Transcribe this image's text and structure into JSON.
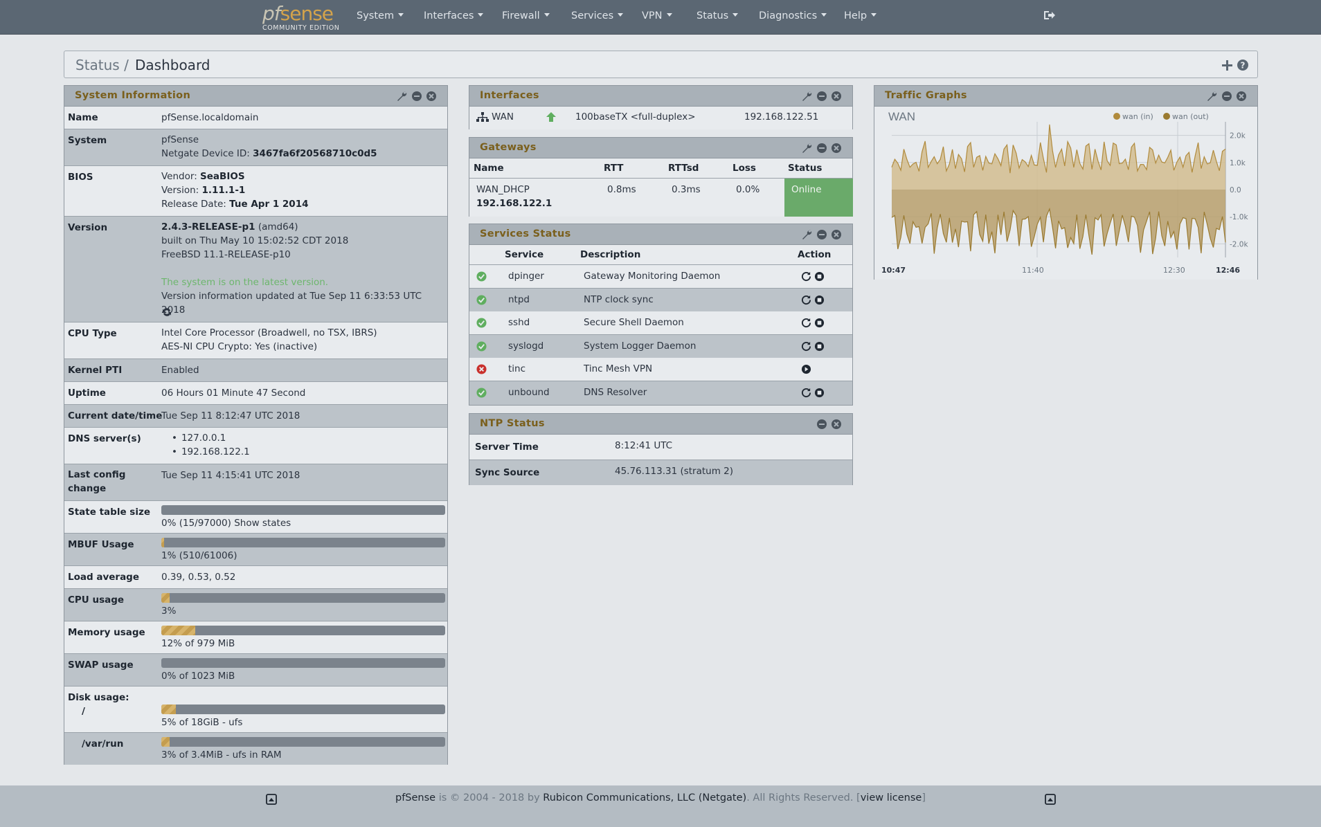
{
  "navbar": {
    "logo_main_pf": "pf",
    "logo_main_sense": "sense",
    "logo_sub": "COMMUNITY EDITION",
    "menu": [
      "System",
      "Interfaces",
      "Firewall",
      "Services",
      "VPN",
      "Status",
      "Diagnostics",
      "Help"
    ]
  },
  "breadcrumb": {
    "parent": "Status /",
    "current": "Dashboard"
  },
  "system_info": {
    "title": "System Information",
    "name_label": "Name",
    "name_value": "pfSense.localdomain",
    "system_label": "System",
    "system_value": "pfSense",
    "device_id_prefix": "Netgate Device ID:",
    "device_id": "3467fa6f20568710c0d5",
    "bios_label": "BIOS",
    "bios_vendor_prefix": "Vendor:",
    "bios_vendor": "SeaBIOS",
    "bios_version_prefix": "Version:",
    "bios_version": "1.11.1-1",
    "bios_date_prefix": "Release Date:",
    "bios_date": "Tue Apr 1 2014",
    "version_label": "Version",
    "version_value": "2.4.3-RELEASE-p1",
    "version_arch": "(amd64)",
    "version_built": "built on Thu May 10 15:02:52 CDT 2018",
    "version_freebsd": "FreeBSD 11.1-RELEASE-p10",
    "version_latest": "The system is on the latest version.",
    "version_updated": "Version information updated at Tue Sep 11 6:33:53 UTC 2018",
    "cpu_label": "CPU Type",
    "cpu_value": "Intel Core Processor (Broadwell, no TSX, IBRS)",
    "cpu_crypto": "AES-NI CPU Crypto: Yes (inactive)",
    "kpti_label": "Kernel PTI",
    "kpti_value": "Enabled",
    "uptime_label": "Uptime",
    "uptime_value": "06 Hours 01 Minute 47 Second",
    "datetime_label": "Current date/time",
    "datetime_value": "Tue Sep 11 8:12:47 UTC 2018",
    "dns_label": "DNS server(s)",
    "dns_1": "127.0.0.1",
    "dns_2": "192.168.122.1",
    "lastconfig_label": "Last config change",
    "lastconfig_value": "Tue Sep 11 4:15:41 UTC 2018",
    "state_label": "State table size",
    "state_value": "0% (15/97000)",
    "state_link": "Show states",
    "state_pct": 0,
    "mbuf_label": "MBUF Usage",
    "mbuf_value": "1% (510/61006)",
    "mbuf_pct": 1,
    "load_label": "Load average",
    "load_value": "0.39, 0.53, 0.52",
    "cpu_usage_label": "CPU usage",
    "cpu_usage_value": "3%",
    "cpu_usage_pct": 3,
    "mem_label": "Memory usage",
    "mem_value": "12% of 979 MiB",
    "mem_pct": 12,
    "swap_label": "SWAP usage",
    "swap_value": "0% of 1023 MiB",
    "swap_pct": 0,
    "disk_label": "Disk usage:",
    "disk_root_label": "/",
    "disk_root_value": "5% of 18GiB - ufs",
    "disk_root_pct": 5,
    "disk_varrun_label": "/var/run",
    "disk_varrun_value": "3% of 3.4MiB - ufs in RAM",
    "disk_varrun_pct": 3
  },
  "interfaces": {
    "title": "Interfaces",
    "rows": [
      {
        "name": "WAN",
        "media": "100baseTX <full-duplex>",
        "ip": "192.168.122.51"
      }
    ]
  },
  "gateways": {
    "title": "Gateways",
    "headers": [
      "Name",
      "RTT",
      "RTTsd",
      "Loss",
      "Status"
    ],
    "rows": [
      {
        "name": "WAN_DHCP",
        "ip": "192.168.122.1",
        "rtt": "0.8ms",
        "rttsd": "0.3ms",
        "loss": "0.0%",
        "status": "Online"
      }
    ],
    "status_color": "#6aaa6a"
  },
  "services": {
    "title": "Services Status",
    "headers": [
      "Service",
      "Description",
      "Action"
    ],
    "rows": [
      {
        "service": "dpinger",
        "description": "Gateway Monitoring Daemon",
        "running": true
      },
      {
        "service": "ntpd",
        "description": "NTP clock sync",
        "running": true
      },
      {
        "service": "sshd",
        "description": "Secure Shell Daemon",
        "running": true
      },
      {
        "service": "syslogd",
        "description": "System Logger Daemon",
        "running": true
      },
      {
        "service": "tinc",
        "description": "Tinc Mesh VPN",
        "running": false
      },
      {
        "service": "unbound",
        "description": "DNS Resolver",
        "running": true
      }
    ]
  },
  "ntp": {
    "title": "NTP Status",
    "server_time_label": "Server Time",
    "server_time_value": "8:12:41 UTC",
    "sync_label": "Sync Source",
    "sync_value": "45.76.113.31 (stratum 2)"
  },
  "traffic": {
    "title": "Traffic Graphs",
    "interface": "WAN",
    "legend": [
      "wan (in)",
      "wan (out)"
    ],
    "yticks": [
      "2.0k",
      "1.0k",
      "0.0",
      "-1.0k",
      "-2.0k"
    ],
    "xticks": [
      "10:47",
      "11:40",
      "12:30",
      "12:46"
    ],
    "colors": {
      "in": "#b08a3c",
      "out": "#9a7a30",
      "fill_in": "#d2bd8f",
      "fill_out": "#b9a06c"
    }
  },
  "chart_data": {
    "type": "area",
    "title": "WAN",
    "series": [
      {
        "name": "wan (in)"
      },
      {
        "name": "wan (out)"
      }
    ],
    "ylim": [
      -2.5,
      2.5
    ],
    "y_ticks": [
      2.0,
      1.0,
      0.0,
      -1.0,
      -2.0
    ],
    "x_ticks": [
      "10:47",
      "11:40",
      "12:30",
      "12:46"
    ],
    "grid": true,
    "legend": "top-right"
  },
  "footer": {
    "brand": "pfSense",
    "text_mid": " is © 2004 - 2018 by ",
    "company": "Rubicon Communications, LLC (Netgate)",
    "text_end": ". All Rights Reserved. [",
    "license": "view license",
    "close": "]"
  }
}
